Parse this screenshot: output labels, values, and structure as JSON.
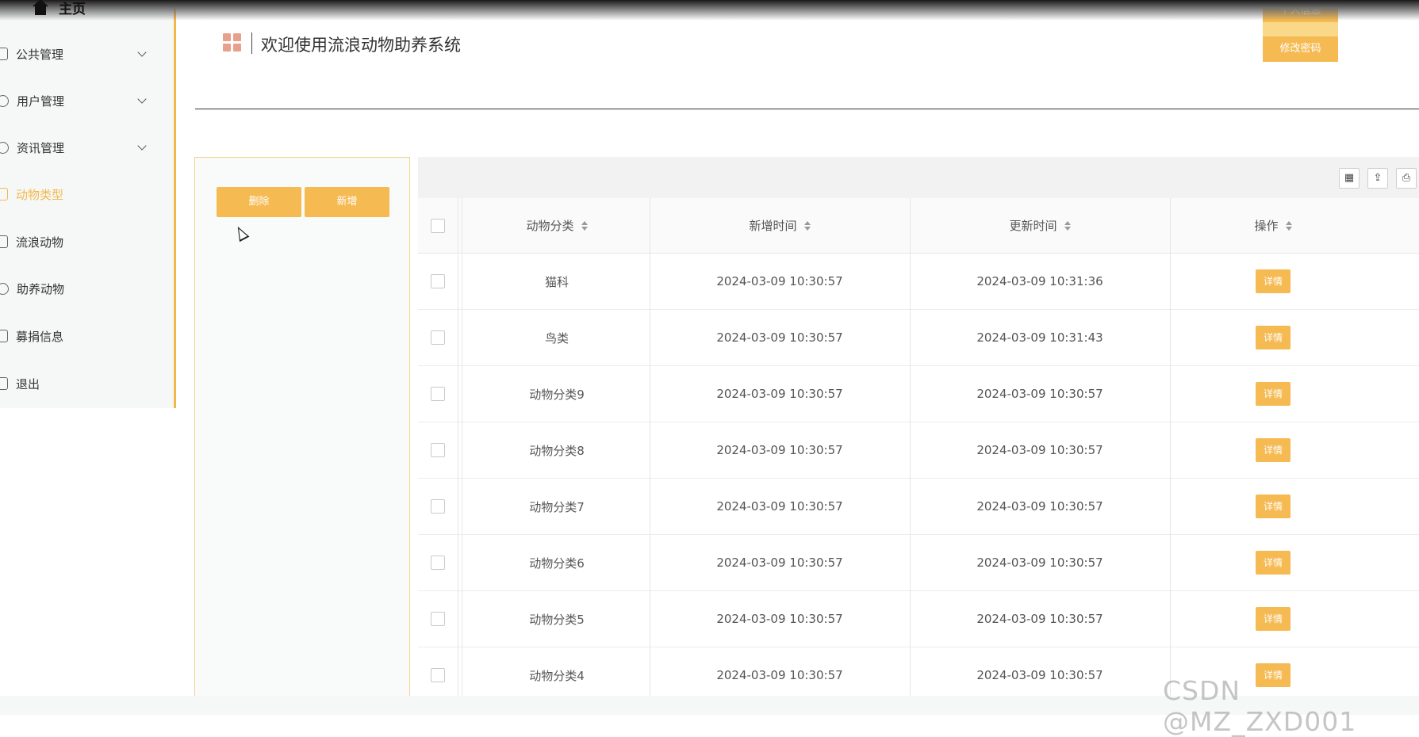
{
  "app": {
    "title": "欢迎使用流浪动物助养系统",
    "top_buttons": {
      "profile": "个人信息",
      "change_password": "修改密码"
    }
  },
  "sidebar": {
    "home": "主页",
    "items": [
      {
        "label": "公共管理",
        "icon": "clipboard-icon",
        "expandable": true
      },
      {
        "label": "用户管理",
        "icon": "pie-icon",
        "expandable": true
      },
      {
        "label": "资讯管理",
        "icon": "compass-icon",
        "expandable": true
      },
      {
        "label": "动物类型",
        "icon": "edit-icon",
        "active": true
      },
      {
        "label": "流浪动物",
        "icon": "search-doc-icon"
      },
      {
        "label": "助养动物",
        "icon": "coin-icon"
      },
      {
        "label": "募捐信息",
        "icon": "bar-chart-icon"
      },
      {
        "label": "退出",
        "icon": "exit-icon"
      }
    ]
  },
  "actions": {
    "delete": "删除",
    "add": "新增"
  },
  "table": {
    "columns": [
      "动物分类",
      "新增时间",
      "更新时间",
      "操作"
    ],
    "detail_label": "详情",
    "rows": [
      {
        "category": "猫科",
        "created": "2024-03-09 10:30:57",
        "updated": "2024-03-09 10:31:36"
      },
      {
        "category": "鸟类",
        "created": "2024-03-09 10:30:57",
        "updated": "2024-03-09 10:31:43"
      },
      {
        "category": "动物分类9",
        "created": "2024-03-09 10:30:57",
        "updated": "2024-03-09 10:30:57"
      },
      {
        "category": "动物分类8",
        "created": "2024-03-09 10:30:57",
        "updated": "2024-03-09 10:30:57"
      },
      {
        "category": "动物分类7",
        "created": "2024-03-09 10:30:57",
        "updated": "2024-03-09 10:30:57"
      },
      {
        "category": "动物分类6",
        "created": "2024-03-09 10:30:57",
        "updated": "2024-03-09 10:30:57"
      },
      {
        "category": "动物分类5",
        "created": "2024-03-09 10:30:57",
        "updated": "2024-03-09 10:30:57"
      },
      {
        "category": "动物分类4",
        "created": "2024-03-09 10:30:57",
        "updated": "2024-03-09 10:30:57"
      }
    ]
  },
  "toolbar_icons": [
    "column-filter-icon",
    "export-icon",
    "print-icon"
  ],
  "watermark": "CSDN @MZ_ZXD001",
  "colors": {
    "accent": "#f5ba52",
    "sidebar_bg": "#f6f8f8",
    "logo": "#e8a08c"
  }
}
